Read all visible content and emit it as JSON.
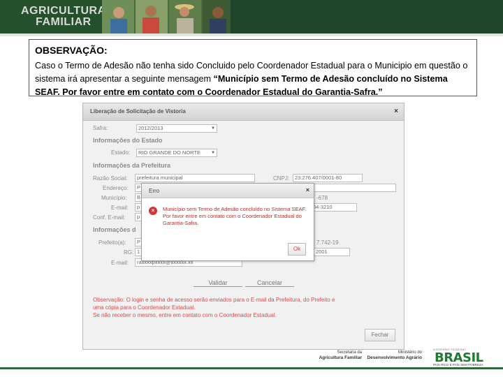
{
  "banner": {
    "title_line1": "AGRICULTURA",
    "title_line2": "FAMILIAR"
  },
  "observation": {
    "title": "OBSERVAÇÃO:",
    "text_plain": "Caso o Termo de Adesão não tenha sido Concluido pelo Coordenador Estadual para o Municipio em questão o sistema irá apresentar a seguinte mensagem ",
    "text_bold": "“Município sem Termo de Adesão concluído no Sistema SEAF. Por favor entre em contato com o Coordenador Estadual do Garantia-Safra.”"
  },
  "window": {
    "title": "Liberação de Solicitação de Vistoria",
    "close": "×",
    "safra_label": "Safra:",
    "safra_value": "2012/2013",
    "section_estado": "Informações do Estado",
    "estado_label": "Estado:",
    "estado_value": "RIO GRANDE DO NORTE",
    "section_prefeitura": "Informações da Prefeitura",
    "razao_label": "Razão Social:",
    "razao_value": "prefeitura municipal",
    "cnpj_label": "CNPJ:",
    "cnpj_value": "23.276.407/0001-80",
    "endereco_label": "Endereço:",
    "endereco_value": "P",
    "municipio_label": "Município:",
    "municipio_value": "B",
    "municipio_right": "-678",
    "email_label": "E-mail:",
    "email_value": "p",
    "email_right": "04-3210",
    "conf_email_label": "Conf. E-mail:",
    "conf_email_value": "p",
    "section_partial": "Informações d",
    "prefeito_label": "Prefeito(a):",
    "prefeito_value": "P",
    "prefeito_right": "7.742-19",
    "rg_label": "RG:",
    "rg_value": "1",
    "rg_right": "2001",
    "email2_label": "E-mail:",
    "email2_value": "raxxxxpxxxx@xxxxxx.xx",
    "validar": "Validar",
    "cancelar": "Cancelar",
    "note_line1": "Observação: O login e senha de acesso serão enviados para o E-mail da Prefeitura, do Prefeito e",
    "note_line2": "uma cópia para o Coordenador Estadual.",
    "note_line3": "Se não receber o mesmo, entre em contato com o Coordenador Estadual.",
    "fechar": "Fechar"
  },
  "dialog": {
    "title": "Erro",
    "close": "×",
    "message": "Município sem Termo de Adesão concluído no Sistema SEAF. Por favor entre em contato com o Coordenador Estadual do Garantia-Safra.",
    "ok": "Ok",
    "icon_glyph": "×"
  },
  "footer": {
    "secretaria_line1": "Secretaria da",
    "secretaria_line2": "Agricultura Familiar",
    "ministerio_line1": "Ministério do",
    "ministerio_line2": "Desenvolvimento Agrário",
    "brasil_top": "GOVERNO FEDERAL",
    "brasil_word": "BRASIL",
    "brasil_sub": "PAÍS RICO É PAÍS SEM POBREZA"
  },
  "colors": {
    "banner": "#24502c",
    "error_red": "#d63434",
    "note_red": "#d74b4b",
    "brasil_green": "#1f7a32"
  }
}
